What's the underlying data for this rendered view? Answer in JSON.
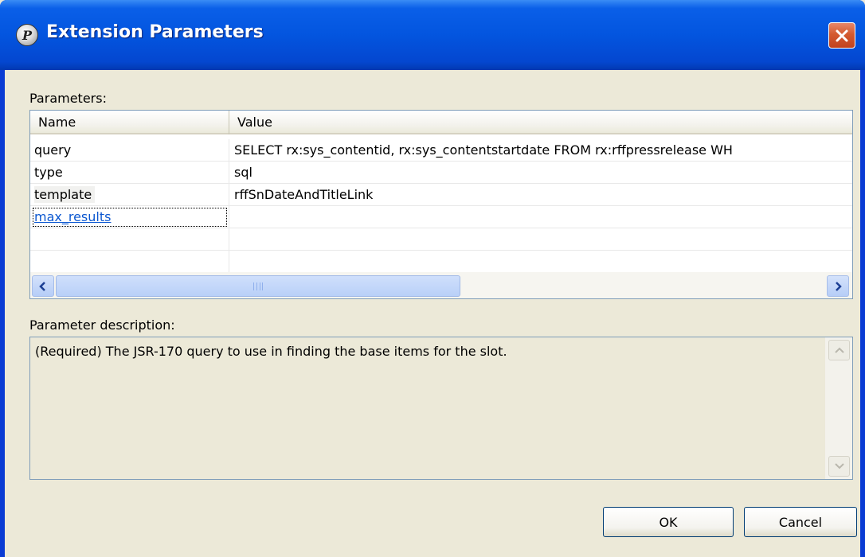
{
  "window": {
    "title": "Extension Parameters",
    "title_icon": "app-icon",
    "close_icon": "close-icon"
  },
  "parameters": {
    "label": "Parameters:",
    "columns": [
      "Name",
      "Value"
    ],
    "rows": [
      {
        "name": "query",
        "value": "SELECT rx:sys_contentid, rx:sys_contentstartdate FROM rx:rffpressrelease WH"
      },
      {
        "name": "type",
        "value": "sql"
      },
      {
        "name": "template",
        "value": "rffSnDateAndTitleLink"
      },
      {
        "name": "max_results",
        "value": ""
      },
      {
        "name": "",
        "value": ""
      },
      {
        "name": "",
        "value": ""
      }
    ],
    "scroll_left_icon": "chevron-left-icon",
    "scroll_right_icon": "chevron-right-icon"
  },
  "description": {
    "label": "Parameter description:",
    "text": "(Required) The JSR-170 query to use in finding the base items for the slot."
  },
  "buttons": {
    "ok": "OK",
    "cancel": "Cancel"
  },
  "colors": {
    "titlebar": "#0355df",
    "dialog_bg": "#ece9d8",
    "close_button": "#d45a2f",
    "link": "#0b57d0"
  }
}
